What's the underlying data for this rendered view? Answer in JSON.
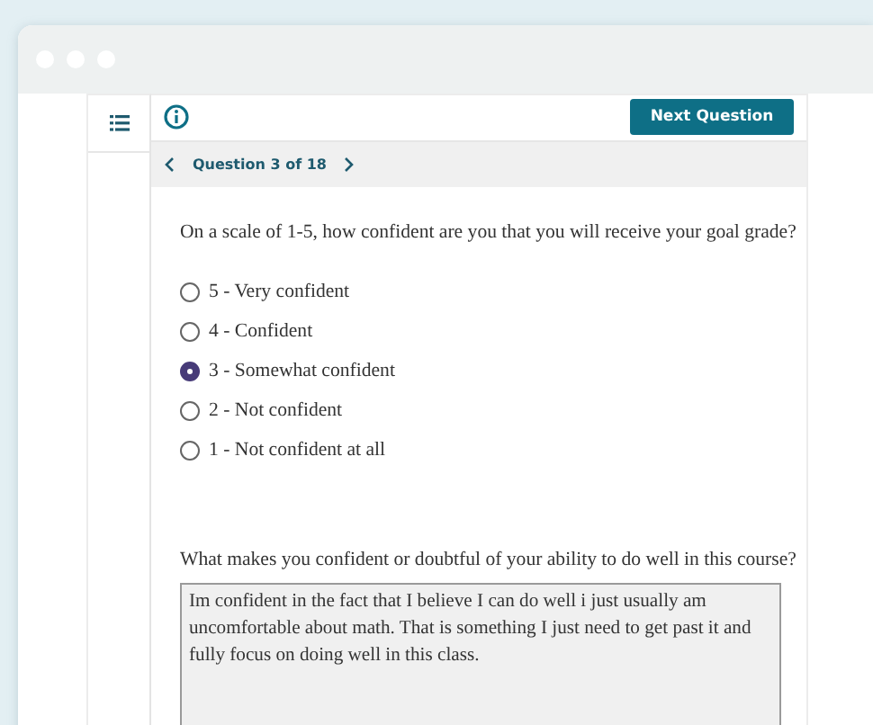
{
  "toolbar": {
    "next_button": "Next Question"
  },
  "navigation": {
    "label": "Question 3 of 18"
  },
  "questions": [
    {
      "kind": "radio",
      "prompt": "On a scale of 1-5, how confident are you that you will receive your goal grade?",
      "options": [
        {
          "label": "5 - Very confident",
          "selected": false
        },
        {
          "label": "4 - Confident",
          "selected": false
        },
        {
          "label": "3 - Somewhat confident",
          "selected": true
        },
        {
          "label": "2 - Not confident",
          "selected": false
        },
        {
          "label": "1 - Not confident at all",
          "selected": false
        }
      ]
    },
    {
      "kind": "text",
      "prompt": "What makes you confident or doubtful of your ability to do well in this course?",
      "value": "Im confident in the fact that I believe I can do well i just usually am uncomfortable about math. That is something I just need to get past it and fully focus on doing well in this class."
    }
  ]
}
